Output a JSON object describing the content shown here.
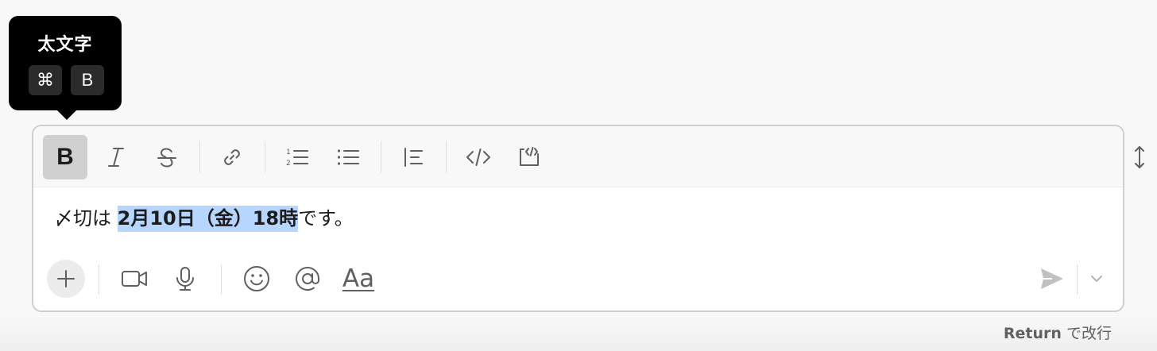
{
  "tooltip": {
    "title": "太文字",
    "keys": [
      "⌘",
      "B"
    ]
  },
  "toolbar": {
    "buttons": [
      {
        "name": "bold",
        "icon": "bold-icon",
        "active": true
      },
      {
        "name": "italic",
        "icon": "italic-icon"
      },
      {
        "name": "strikethrough",
        "icon": "strikethrough-icon"
      },
      {
        "name": "link",
        "icon": "link-icon"
      },
      {
        "name": "ordered-list",
        "icon": "ordered-list-icon"
      },
      {
        "name": "bulleted-list",
        "icon": "bulleted-list-icon"
      },
      {
        "name": "blockquote",
        "icon": "blockquote-icon"
      },
      {
        "name": "code",
        "icon": "code-icon"
      },
      {
        "name": "code-block",
        "icon": "code-block-icon"
      }
    ],
    "bold_glyph": "B"
  },
  "editor": {
    "before": "〆切は",
    "selected_bold": "2月10日（金）18時",
    "after": "です。"
  },
  "bottom_bar": {
    "buttons": [
      "plus-icon",
      "video-icon",
      "microphone-icon",
      "emoji-icon",
      "mention-icon",
      "formatting-icon",
      "send-icon",
      "chevron-down-icon"
    ],
    "formatting_label": "Aa"
  },
  "hint": {
    "key": "Return",
    "text": "で改行"
  },
  "colors": {
    "selection": "#b6d6ff",
    "active_button": "#d0d0d0",
    "icon": "#616061",
    "tooltip_bg": "#000000"
  }
}
